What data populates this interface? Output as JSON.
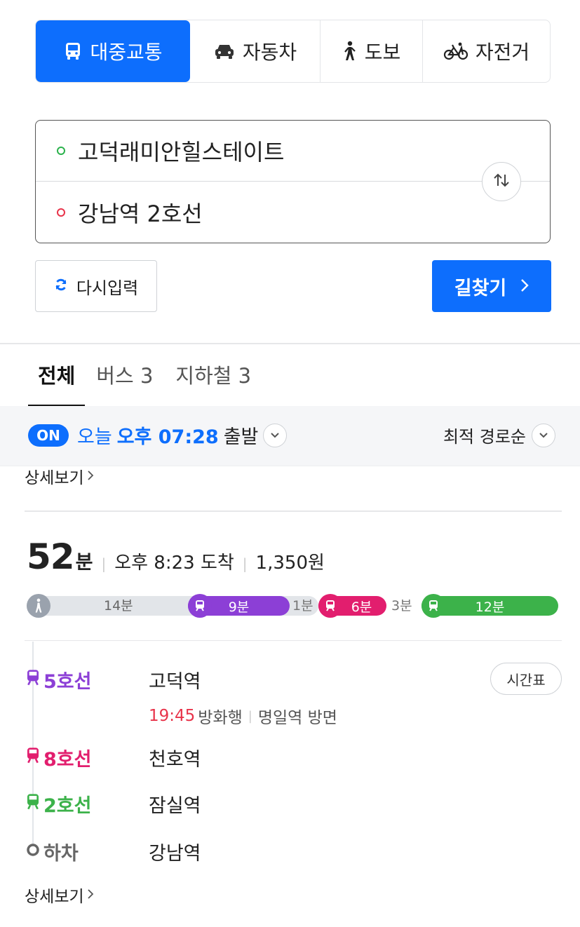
{
  "modes": [
    {
      "label": "대중교통",
      "icon": "bus-icon",
      "active": true
    },
    {
      "label": "자동차",
      "icon": "car-icon",
      "active": false
    },
    {
      "label": "도보",
      "icon": "walk-icon",
      "active": false
    },
    {
      "label": "자전거",
      "icon": "bicycle-icon",
      "active": false
    }
  ],
  "route": {
    "origin": "고덕래미안힐스테이트",
    "destination": "강남역 2호선"
  },
  "buttons": {
    "reset": "다시입력",
    "search": "길찾기"
  },
  "filter_tabs": [
    {
      "label": "전체",
      "active": true
    },
    {
      "label": "버스 3",
      "active": false
    },
    {
      "label": "지하철 3",
      "active": false
    }
  ],
  "departure": {
    "badge": "ON",
    "day": "오늘",
    "time": "오후 07:28",
    "suffix": "출발",
    "sort": "최적 경로순"
  },
  "detail_link": "상세보기",
  "result": {
    "duration": "52",
    "duration_unit": "분",
    "arrival": "오후 8:23 도착",
    "fare": "1,350원",
    "segments": {
      "walk": "14분",
      "line5": "9분",
      "gap1": "1분",
      "line8": "6분",
      "gap2": "3분",
      "line2": "12분"
    },
    "colors": {
      "line5": "#8c3fd6",
      "line8": "#e21e6e",
      "line2": "#3cb24a",
      "walk": "#9aa2ad"
    },
    "steps": [
      {
        "line": "5호선",
        "station": "고덕역"
      },
      {
        "line": "8호선",
        "station": "천호역"
      },
      {
        "line": "2호선",
        "station": "잠실역"
      },
      {
        "line": "하차",
        "station": "강남역"
      }
    ],
    "first_step_detail": {
      "time": "19:45",
      "direction": "방화행",
      "platform": "명일역 방면"
    },
    "timetable_label": "시간표"
  }
}
